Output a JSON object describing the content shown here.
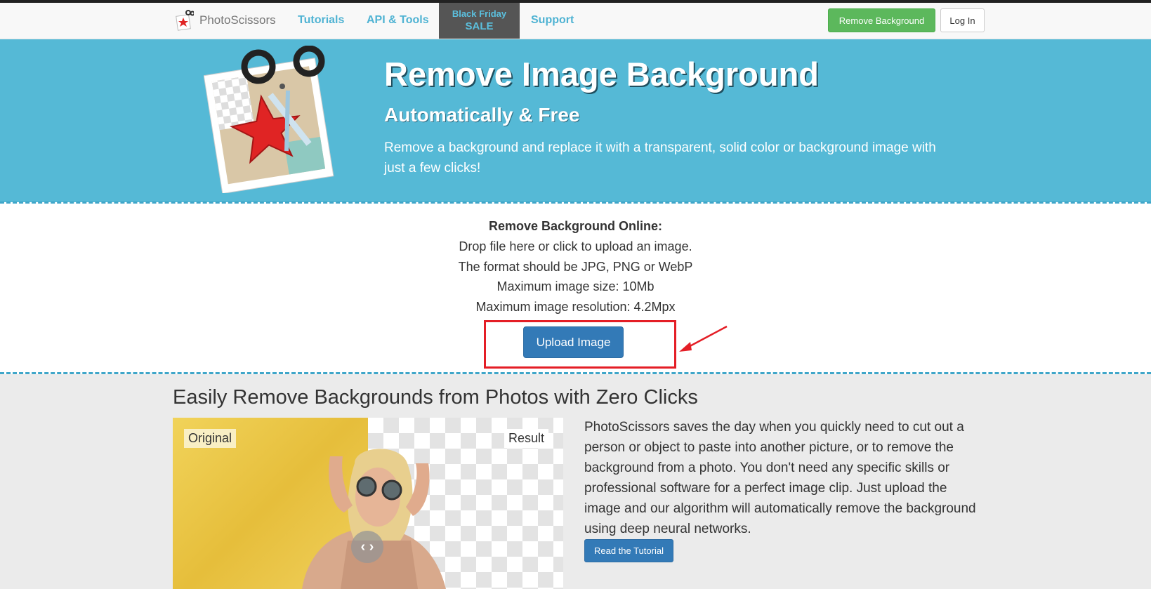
{
  "navbar": {
    "brand": "PhotoScissors",
    "links": [
      "Tutorials",
      "API & Tools",
      "Support"
    ],
    "promo": {
      "line1": "Black Friday",
      "line2": "SALE"
    },
    "remove_bg_button": "Remove Background",
    "login_button": "Log In"
  },
  "hero": {
    "title": "Remove Image Background",
    "subtitle": "Automatically & Free",
    "description": "Remove a background and replace it with a transparent, solid color or background image with just a few clicks!"
  },
  "upload": {
    "heading": "Remove Background Online:",
    "lines": [
      "Drop file here or click to upload an image.",
      "The format should be JPG, PNG or WebP",
      "Maximum image size: 10Mb",
      "Maximum image resolution: 4.2Mpx"
    ],
    "button": "Upload Image"
  },
  "demo": {
    "title": "Easily Remove Backgrounds from Photos with Zero Clicks",
    "original_label": "Original",
    "result_label": "Result",
    "slider_glyph": "‹ ›",
    "description": "PhotoScissors saves the day when you quickly need to cut out a person or object to paste into another picture, or to remove the background from a photo. You don't need any specific skills or professional software for a perfect image clip. Just upload the image and our algorithm will automatically remove the background using deep neural networks.",
    "tutorial_button": "Read the Tutorial"
  },
  "colors": {
    "hero_bg": "#55b9d6",
    "link": "#4fb3d3",
    "green_button": "#5cb85c",
    "primary_button": "#337ab7",
    "highlight": "#e41e26"
  },
  "icons": [
    "photoscissors-logo-icon",
    "scissors-starfish-illustration",
    "slider-arrows-icon",
    "annotation-arrow"
  ]
}
